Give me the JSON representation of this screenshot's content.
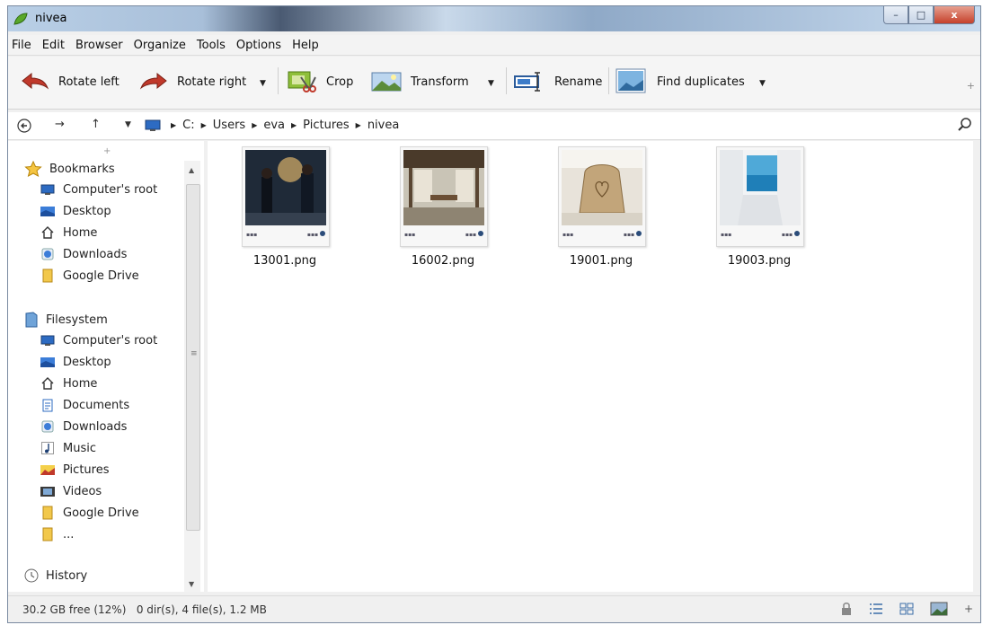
{
  "window": {
    "title": "nivea",
    "minimize": "–",
    "maximize": "□",
    "close": "x"
  },
  "menu": [
    "File",
    "Edit",
    "Browser",
    "Organize",
    "Tools",
    "Options",
    "Help"
  ],
  "toolbar": {
    "rotate_left": "Rotate left",
    "rotate_right": "Rotate right",
    "crop": "Crop",
    "transform": "Transform",
    "rename": "Rename",
    "find_duplicates": "Find duplicates",
    "plus": "+"
  },
  "address": {
    "crumbs": [
      "C:",
      "Users",
      "eva",
      "Pictures",
      "nivea"
    ]
  },
  "sidebar": {
    "plus": "+",
    "bookmarks_label": "Bookmarks",
    "bookmarks": [
      {
        "label": "Computer's root",
        "icon": "computer-icon"
      },
      {
        "label": "Desktop",
        "icon": "desktop-icon"
      },
      {
        "label": "Home",
        "icon": "home-icon"
      },
      {
        "label": "Downloads",
        "icon": "downloads-icon"
      },
      {
        "label": "Google Drive",
        "icon": "folder-icon"
      }
    ],
    "filesystem_label": "Filesystem",
    "filesystem": [
      {
        "label": "Computer's root",
        "icon": "computer-icon"
      },
      {
        "label": "Desktop",
        "icon": "desktop-icon"
      },
      {
        "label": "Home",
        "icon": "home-icon"
      },
      {
        "label": "Documents",
        "icon": "documents-icon"
      },
      {
        "label": "Downloads",
        "icon": "downloads-icon"
      },
      {
        "label": "Music",
        "icon": "music-icon"
      },
      {
        "label": "Pictures",
        "icon": "pictures-icon"
      },
      {
        "label": "Videos",
        "icon": "videos-icon"
      },
      {
        "label": "Google Drive",
        "icon": "folder-icon"
      },
      {
        "label": "...",
        "icon": "folder-icon"
      }
    ],
    "history_label": "History"
  },
  "files": [
    {
      "name": "13001.png"
    },
    {
      "name": "16002.png"
    },
    {
      "name": "19001.png"
    },
    {
      "name": "19003.png"
    }
  ],
  "status": {
    "text": "30.2 GB free (12%)   0 dir(s), 4 file(s), 1.2 MB",
    "plus": "+"
  }
}
